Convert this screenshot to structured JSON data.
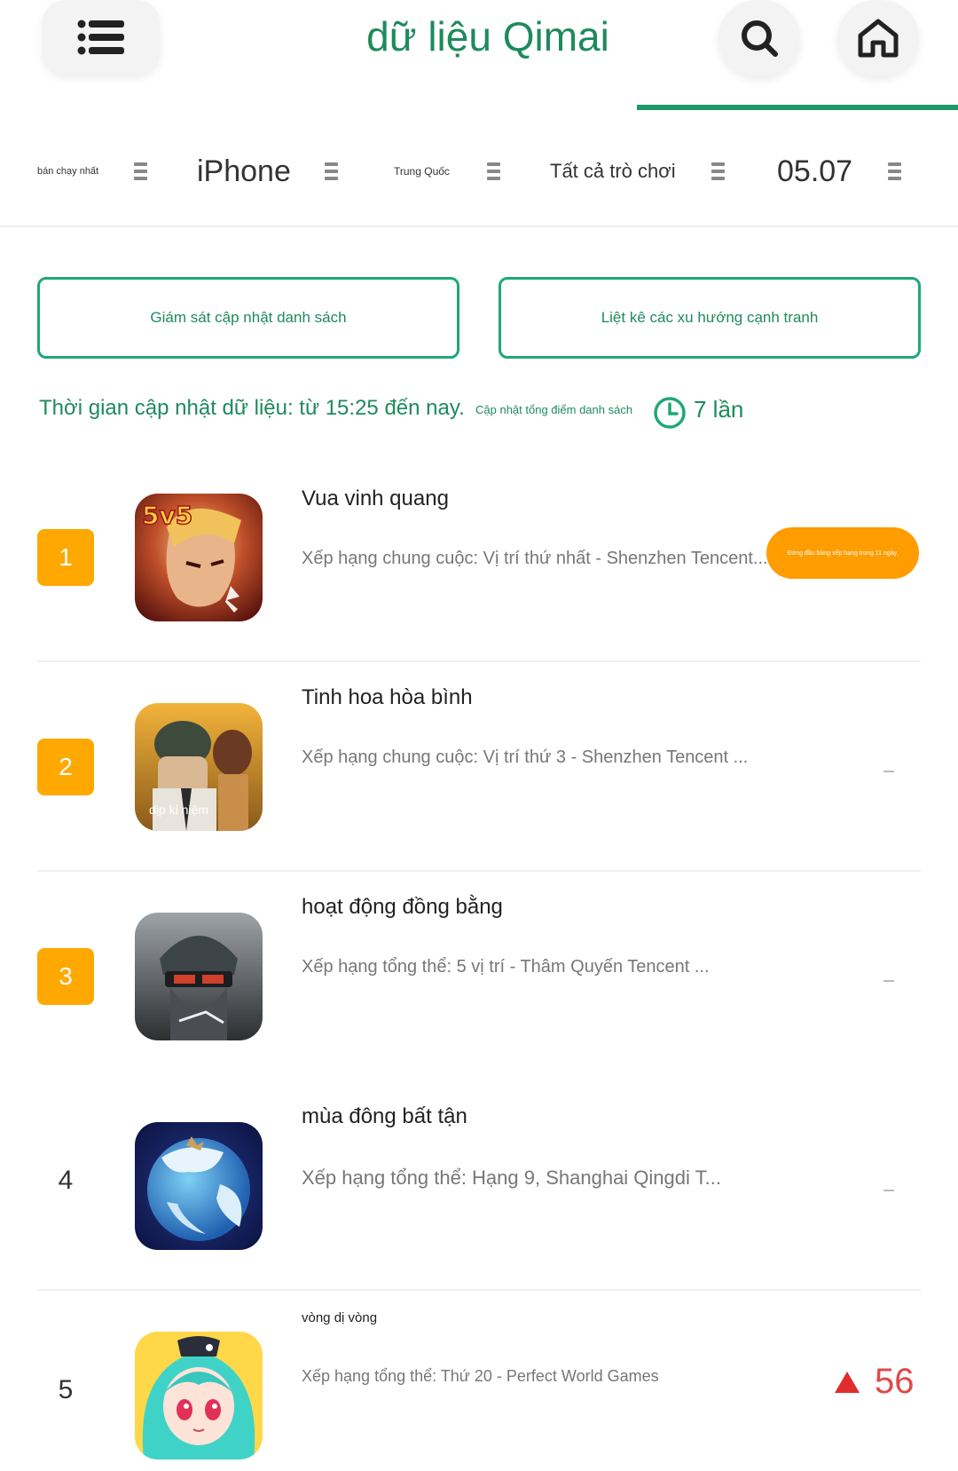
{
  "header": {
    "title": "dữ liệu Qimai"
  },
  "filters": [
    {
      "label": "bán chạy nhất"
    },
    {
      "label": "iPhone"
    },
    {
      "label": "Trung Quốc"
    },
    {
      "label": "Tất cả trò chơi"
    },
    {
      "label": "05.07"
    }
  ],
  "actions": {
    "monitor_label": "Giám sát cập nhật danh sách",
    "trend_label": "Liệt kê các xu hướng cạnh tranh"
  },
  "update": {
    "time_text": "Thời gian cập nhật dữ liệu: từ 15:25 đến nay.",
    "total_text": "Cập nhật tổng điểm danh sách",
    "count_text": "7 lần"
  },
  "apps": [
    {
      "rank": "1",
      "name": "Vua vinh quang",
      "desc": "Xếp hạng chung cuộc: Vị trí thứ nhất - Shenzhen Tencent...",
      "icon": "honor-of-kings-icon",
      "status": "Đứng đầu bảng xếp hạng trong 11 ngày."
    },
    {
      "rank": "2",
      "name": "Tinh hoa hòa bình",
      "desc": "Xếp hạng chung cuộc: Vị trí thứ 3 - Shenzhen Tencent ...",
      "icon": "peacekeeper-elite-icon",
      "icon_caption": "dịp kỉ niệm",
      "status": "-"
    },
    {
      "rank": "3",
      "name": "hoạt động đồng bằng",
      "desc": "Xếp hạng tổng thể: 5 vị trí - Thâm Quyến Tencent ...",
      "icon": "delta-force-icon",
      "status": "-"
    },
    {
      "rank": "4",
      "name": "mùa đông bất tận",
      "desc": "Xếp hạng tổng thể: Hạng 9, Shanghai Qingdi T...",
      "icon": "endless-winter-icon",
      "status": "-"
    },
    {
      "rank": "5",
      "name": "vòng dị vòng",
      "desc": "Xếp hạng tổng thể: Thứ 20 - Perfect World Games",
      "icon": "anime-girl-icon",
      "status": "56"
    }
  ],
  "colors": {
    "accent": "#1e8a5e",
    "badge": "#ffa800",
    "pill": "#ff9c00",
    "rise": "#e04848"
  }
}
